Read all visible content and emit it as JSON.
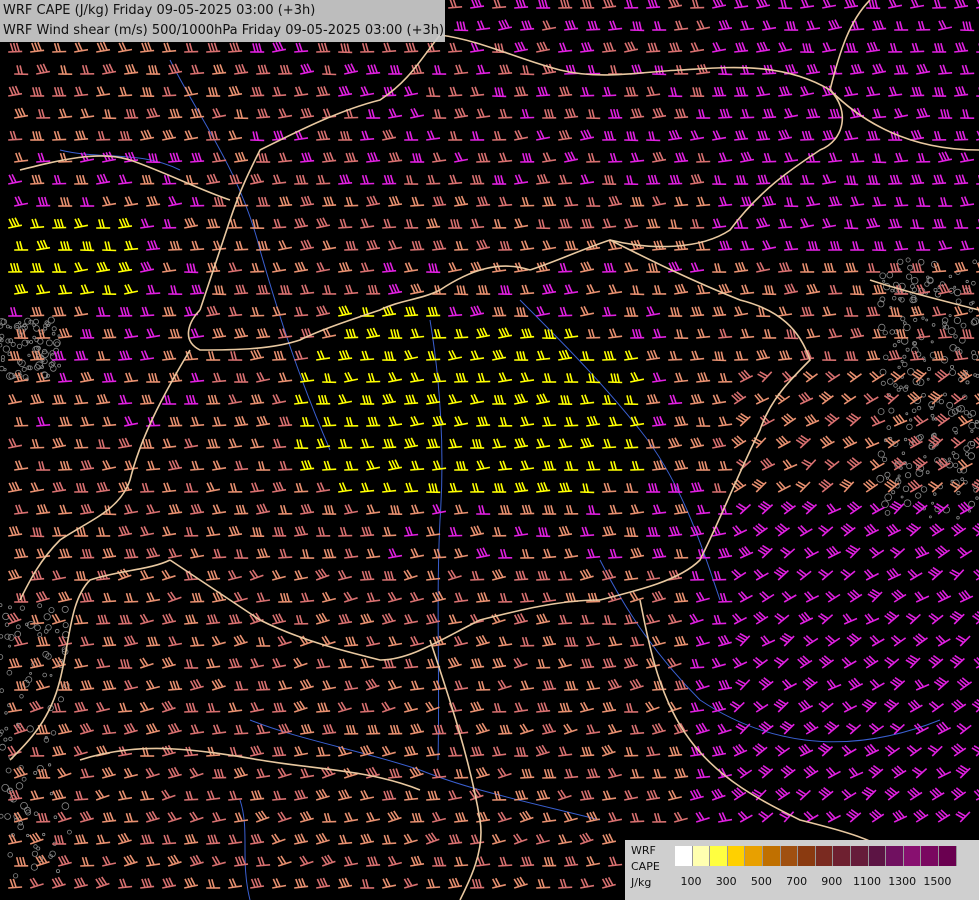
{
  "title": {
    "line1": "WRF CAPE (J/kg) Friday 09-05-2025 03:00 (+3h)",
    "line2": "WRF Wind shear (m/s) 500/1000hPa Friday 09-05-2025 03:00 (+3h)"
  },
  "legend": {
    "label_model": "WRF",
    "label_field": "CAPE",
    "label_unit": "J/kg",
    "tick_labels": [
      "100",
      "300",
      "500",
      "700",
      "900",
      "1100",
      "1300",
      "1500"
    ],
    "colors": [
      "#ffffff",
      "#ffffb0",
      "#ffff40",
      "#ffd000",
      "#e8a000",
      "#c07000",
      "#a05010",
      "#8a3a10",
      "#7a2a20",
      "#6e2030",
      "#661c3a",
      "#5c1444",
      "#701060",
      "#881070",
      "#7a0860",
      "#6a0050"
    ]
  },
  "map_colors": {
    "background": "#000000",
    "border": "#e8c8a0",
    "river": "#3a5fd0",
    "barb_low": "#d87070",
    "barb_mid": "#e89070",
    "barb_high": "#e020e0",
    "barb_cape": "#ffff00",
    "terrain": "#888888"
  }
}
